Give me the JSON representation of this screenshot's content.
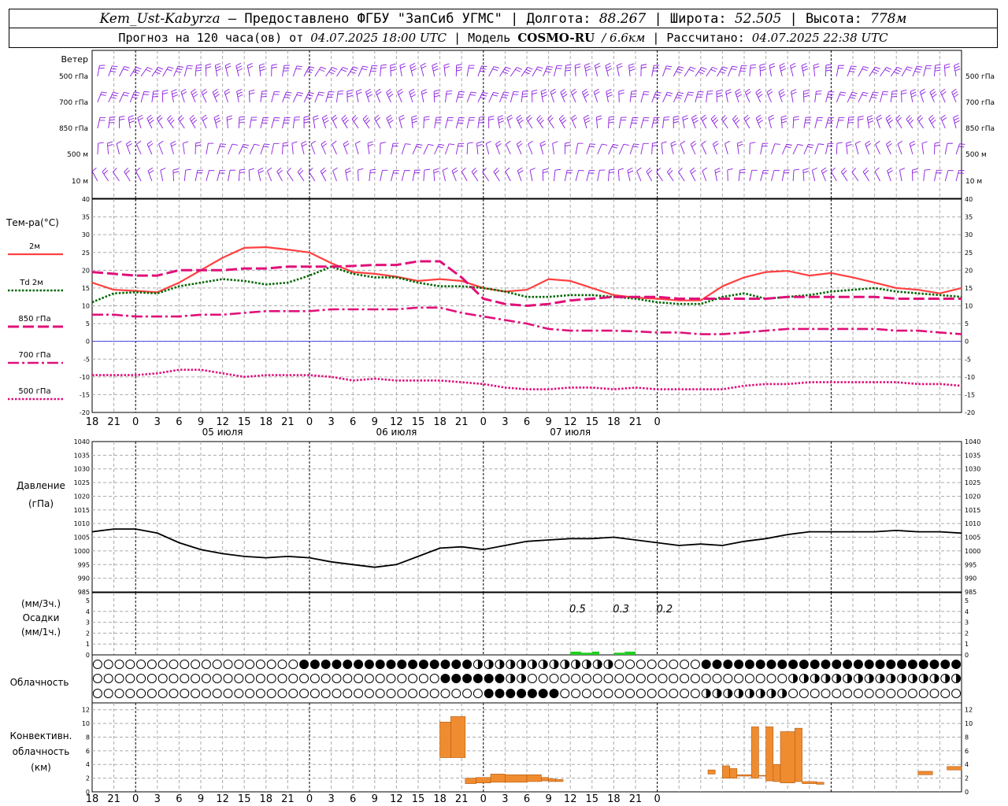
{
  "header": {
    "station": "Kem_Ust-Kabyrza",
    "provider": "— Предоставлено ФГБУ \"ЗапСиб УГМС\"",
    "lon_label": "Долгота:",
    "lon": "88.267",
    "lat_label": "Широта:",
    "lat": "52.505",
    "alt_label": "Высота:",
    "alt": "778м",
    "forecast_label": "Прогноз на 120 часа(ов) от",
    "forecast_from": "04.07.2025 18:00 UTC",
    "model_label": "Модель",
    "model": "COSMO-RU",
    "resolution": "/ 6.6км",
    "calc_label": "Рассчитано:",
    "calc_time": "04.07.2025 22:38 UTC"
  },
  "wind_panel": {
    "title": "Ветер",
    "levels": [
      "500 гПа",
      "700 гПа",
      "850 гПа",
      "500 м",
      "10  м"
    ]
  },
  "temp_panel": {
    "title": "Тем-ра(°С)",
    "legend": [
      {
        "label": "2м",
        "color": "#ff4040",
        "style": "solid"
      },
      {
        "label": "Td 2м",
        "color": "#006600",
        "style": "dotted"
      },
      {
        "label": "850 гПа",
        "color": "#e0107a",
        "style": "dashed"
      },
      {
        "label": "700 гПа",
        "color": "#e0107a",
        "style": "dashdot"
      },
      {
        "label": "500 гПа",
        "color": "#e0107a",
        "style": "dotted"
      }
    ]
  },
  "time_axis": {
    "ticks": [
      "18",
      "21",
      "0",
      "3",
      "6",
      "9",
      "12",
      "15",
      "18",
      "21",
      "0",
      "3",
      "6",
      "9",
      "12",
      "15",
      "18",
      "21",
      "0",
      "3",
      "6",
      "9",
      "12",
      "15",
      "18",
      "21",
      "0"
    ],
    "days": [
      "05 июля",
      "06 июля",
      "07 июля"
    ]
  },
  "pressure_panel": {
    "title": "Давление",
    "unit": "(гПа)"
  },
  "precip_panel": {
    "unit_3h": "(мм/3ч.)",
    "title": "Осадки",
    "unit_1h": "(мм/1ч.)",
    "labels": [
      {
        "h": 66,
        "text": "0.5"
      },
      {
        "h": 72,
        "text": "0.3"
      },
      {
        "h": 78,
        "text": "0.2"
      }
    ]
  },
  "cloud_panel": {
    "title": "Облачность"
  },
  "conv_panel": {
    "title1": "Конвективн.",
    "title2": "облачность",
    "unit": "(км)"
  },
  "chart_data": [
    {
      "type": "line",
      "title": "Тем-ра(°С)",
      "x_hours": [
        0,
        3,
        6,
        9,
        12,
        15,
        18,
        21,
        24,
        27,
        30,
        33,
        36,
        39,
        42,
        45,
        48,
        51,
        54,
        57,
        60,
        63,
        66,
        69,
        72,
        75,
        78,
        81,
        84,
        87,
        90,
        93,
        96,
        99,
        102,
        105,
        108,
        111,
        114,
        117,
        120
      ],
      "ylim": [
        -20,
        40
      ],
      "series": [
        {
          "name": "2м",
          "color": "#ff4040",
          "values": [
            16.5,
            14.5,
            14.2,
            13.8,
            16.5,
            20,
            23.5,
            26.3,
            26.5,
            25.8,
            25,
            22,
            19.5,
            19,
            18.2,
            17,
            17.5,
            17,
            15,
            14,
            14.5,
            17.5,
            17,
            15,
            13,
            12.3,
            12,
            11.5,
            11.5,
            15.5,
            18,
            19.5,
            19.8,
            18.5,
            19.2,
            18,
            16.5,
            15,
            14.5,
            13.5,
            15
          ]
        },
        {
          "name": "Td 2м",
          "color": "#006600",
          "values": [
            11,
            13.5,
            13.8,
            13.5,
            15.5,
            16.5,
            17.5,
            17,
            16,
            16.5,
            18.5,
            21,
            19,
            18,
            18,
            16.5,
            15.5,
            15.5,
            15,
            14,
            12.5,
            12.5,
            13,
            13,
            12.5,
            12,
            11,
            10.5,
            10.5,
            12.5,
            13.5,
            12,
            12.5,
            13,
            14,
            14.5,
            15,
            14,
            13.5,
            13,
            12.5
          ]
        },
        {
          "name": "850 гПа",
          "color": "#e0107a",
          "values": [
            19.5,
            19,
            18.5,
            18.5,
            20,
            20,
            20,
            20.5,
            20.5,
            21,
            21,
            21,
            21.2,
            21.5,
            21.5,
            22.5,
            22.5,
            18,
            12,
            10.5,
            10,
            10.5,
            11.5,
            12,
            12.5,
            12.5,
            12.5,
            12,
            12,
            12,
            12,
            12,
            12.5,
            12.5,
            12.5,
            12.5,
            12.5,
            12,
            12,
            12,
            12
          ]
        },
        {
          "name": "700 гПа",
          "color": "#e0107a",
          "values": [
            7.5,
            7.5,
            7,
            7,
            7,
            7.5,
            7.5,
            8,
            8.5,
            8.5,
            8.5,
            9,
            9,
            9,
            9,
            9.5,
            9.5,
            8,
            7,
            6,
            5,
            3.5,
            3,
            3,
            3,
            2.8,
            2.5,
            2.5,
            2,
            2,
            2.5,
            3,
            3.5,
            3.5,
            3.5,
            3.5,
            3.5,
            3,
            3,
            2.5,
            2
          ]
        },
        {
          "name": "500 гПа",
          "color": "#e0107a",
          "values": [
            -9.5,
            -9.5,
            -9.5,
            -9,
            -8,
            -8,
            -9,
            -10,
            -9.5,
            -9.5,
            -9.5,
            -10,
            -11,
            -10.5,
            -11,
            -11,
            -11,
            -11.5,
            -12,
            -13,
            -13.5,
            -13.5,
            -13,
            -13,
            -13.5,
            -13,
            -13.5,
            -13.5,
            -13.5,
            -13.5,
            -12.5,
            -12,
            -12,
            -11.5,
            -11.5,
            -11.5,
            -11.5,
            -11.5,
            -12,
            -12,
            -12.5
          ]
        }
      ]
    },
    {
      "type": "line",
      "title": "Давление",
      "ylabel": "(гПа)",
      "ylim": [
        985,
        1040
      ],
      "x_hours": [
        0,
        3,
        6,
        9,
        12,
        15,
        18,
        21,
        24,
        27,
        30,
        33,
        36,
        39,
        42,
        45,
        48,
        51,
        54,
        57,
        60,
        63,
        66,
        69,
        72,
        75,
        78,
        81,
        84,
        87,
        90,
        93,
        96,
        99,
        102,
        105,
        108,
        111,
        114,
        117,
        120
      ],
      "series": [
        {
          "name": "pressure",
          "color": "#000000",
          "values": [
            1007,
            1008,
            1008,
            1006.5,
            1003,
            1000.5,
            999,
            998,
            997.5,
            998,
            997.5,
            996,
            995,
            994,
            995,
            998,
            1001,
            1001.5,
            1000.5,
            1002,
            1003.5,
            1004,
            1004.5,
            1004.5,
            1005,
            1004,
            1003,
            1002,
            1002.5,
            1002,
            1003.5,
            1004.5,
            1006,
            1007,
            1007,
            1007,
            1007,
            1007.5,
            1007,
            1007,
            1006.5
          ]
        }
      ]
    },
    {
      "type": "bar",
      "title": "Осадки",
      "ylabel": "(мм/1ч.)",
      "ylim": [
        0,
        5
      ],
      "bars": [
        {
          "h_from": 66,
          "h_to": 67.5,
          "value": 0.3,
          "color": "#22cc22"
        },
        {
          "h_from": 67.5,
          "h_to": 69,
          "value": 0.2,
          "color": "#22cc22"
        },
        {
          "h_from": 69,
          "h_to": 70,
          "value": 0.3,
          "color": "#22cc22"
        },
        {
          "h_from": 72,
          "h_to": 73.5,
          "value": 0.2,
          "color": "#22cc22"
        },
        {
          "h_from": 73.5,
          "h_to": 75,
          "value": 0.3,
          "color": "#22cc22"
        }
      ]
    },
    {
      "type": "bar",
      "title": "Конвективн. облачность",
      "ylabel": "(км)",
      "ylim": [
        0,
        13
      ],
      "bars": [
        {
          "h_from": 48,
          "h_to": 49.5,
          "base": 5,
          "top": 10.2
        },
        {
          "h_from": 49.5,
          "h_to": 51.5,
          "base": 5,
          "top": 11
        },
        {
          "h_from": 51.5,
          "h_to": 53,
          "base": 1.2,
          "top": 2
        },
        {
          "h_from": 53,
          "h_to": 55,
          "base": 1.3,
          "top": 2.1
        },
        {
          "h_from": 55,
          "h_to": 57,
          "base": 1.4,
          "top": 2.6
        },
        {
          "h_from": 57,
          "h_to": 60,
          "base": 1.4,
          "top": 2.5
        },
        {
          "h_from": 60,
          "h_to": 62,
          "base": 1.5,
          "top": 2.5
        },
        {
          "h_from": 62,
          "h_to": 63,
          "base": 1.6,
          "top": 2.1
        },
        {
          "h_from": 63,
          "h_to": 64,
          "base": 1.5,
          "top": 1.9
        },
        {
          "h_from": 64,
          "h_to": 65,
          "base": 1.5,
          "top": 1.8
        },
        {
          "h_from": 85,
          "h_to": 86,
          "base": 2.6,
          "top": 3.2
        },
        {
          "h_from": 87,
          "h_to": 88,
          "base": 2,
          "top": 3.8
        },
        {
          "h_from": 88,
          "h_to": 89,
          "base": 2,
          "top": 3.4
        },
        {
          "h_from": 89,
          "h_to": 91,
          "base": 2.3,
          "top": 2.5
        },
        {
          "h_from": 91,
          "h_to": 92,
          "base": 2,
          "top": 9.5
        },
        {
          "h_from": 92,
          "h_to": 93,
          "base": 2.3,
          "top": 2.4
        },
        {
          "h_from": 93,
          "h_to": 94,
          "base": 1.6,
          "top": 9.5
        },
        {
          "h_from": 94,
          "h_to": 95,
          "base": 1.5,
          "top": 4
        },
        {
          "h_from": 95,
          "h_to": 97,
          "base": 1.3,
          "top": 8.8
        },
        {
          "h_from": 97,
          "h_to": 98,
          "base": 1.5,
          "top": 9.3
        },
        {
          "h_from": 98,
          "h_to": 100,
          "base": 1.2,
          "top": 1.5
        },
        {
          "h_from": 100,
          "h_to": 101,
          "base": 1.1,
          "top": 1.4
        },
        {
          "h_from": 114,
          "h_to": 116,
          "base": 2.5,
          "top": 3
        },
        {
          "h_from": 118,
          "h_to": 120,
          "base": 3.2,
          "top": 3.7
        }
      ]
    }
  ],
  "colors": {
    "wind": "#8a1be0",
    "zero_line": "#4444dd",
    "conv": "#f08c30",
    "precip": "#22cc22"
  }
}
